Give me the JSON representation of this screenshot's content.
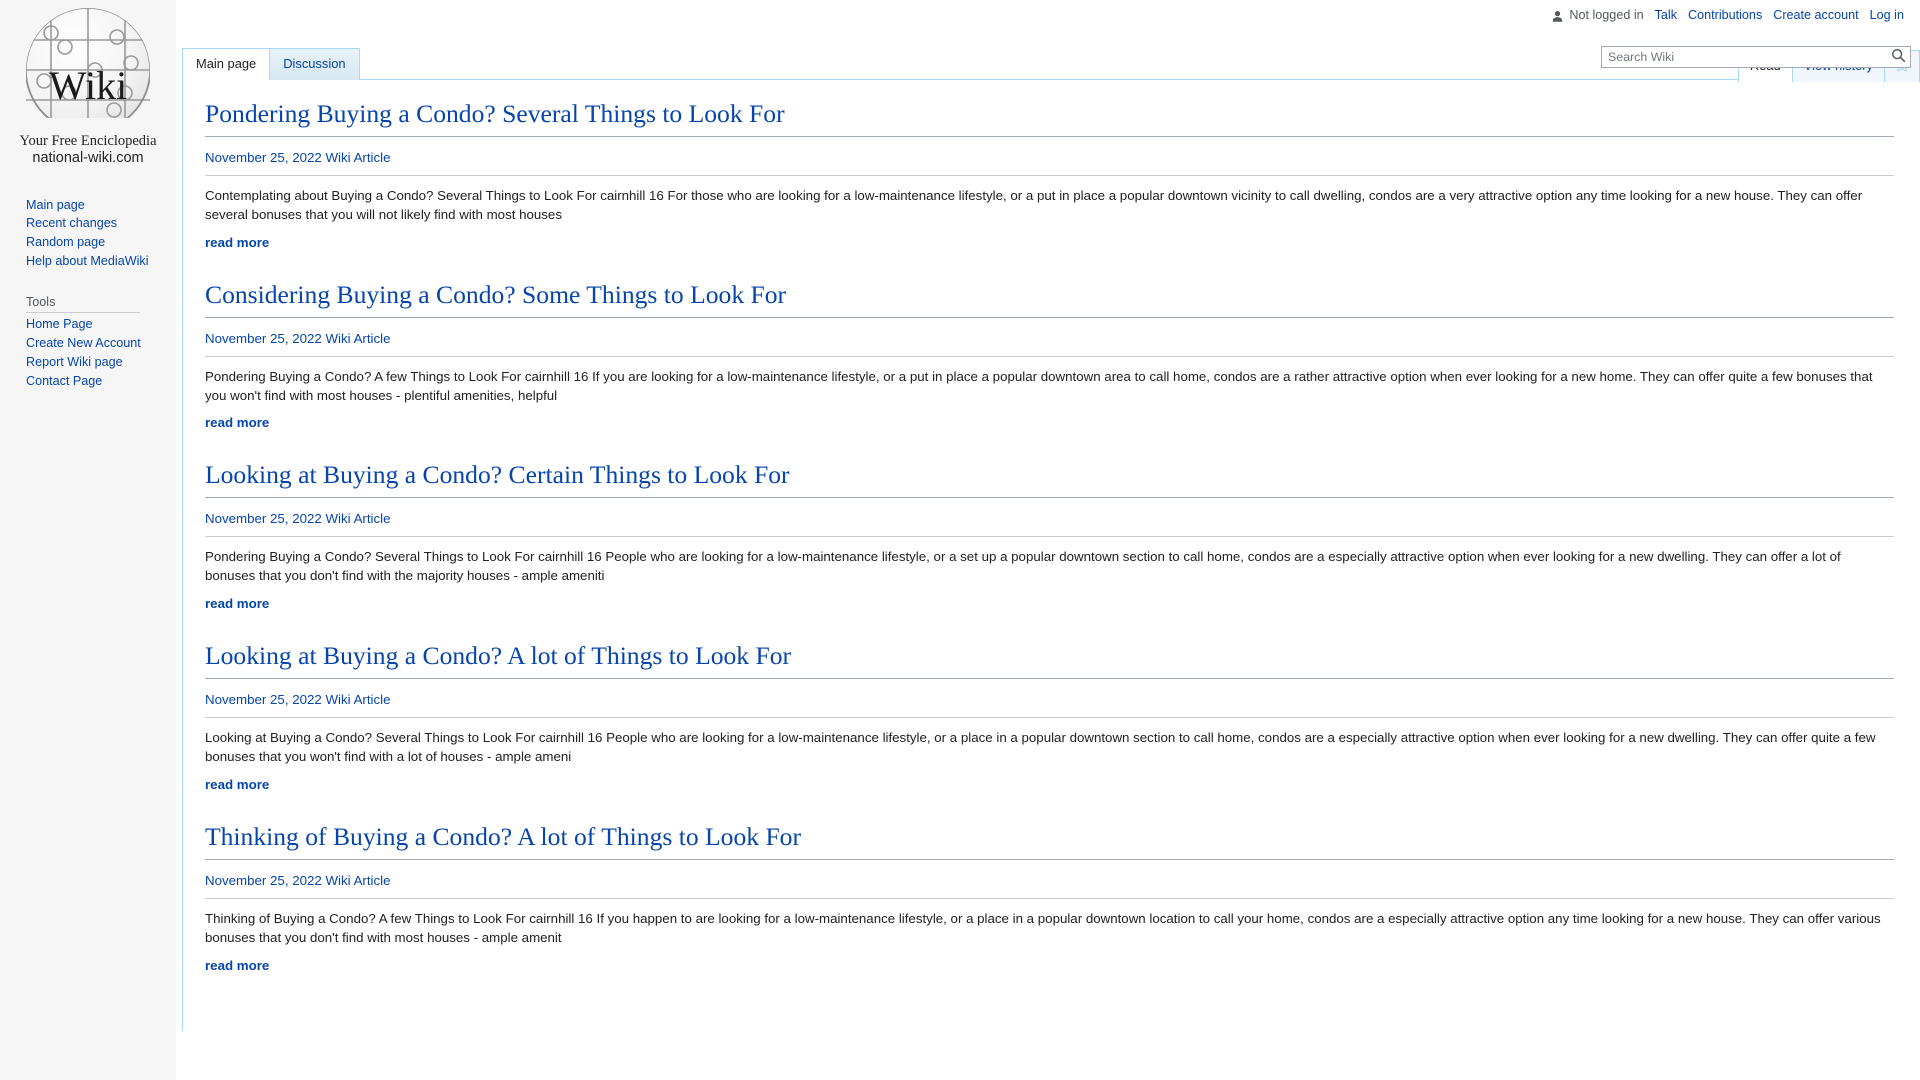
{
  "personal_bar": {
    "user_icon": "user-icon",
    "not_logged_in": "Not logged in",
    "links": [
      {
        "label": "Talk"
      },
      {
        "label": "Contributions"
      },
      {
        "label": "Create account"
      },
      {
        "label": "Log in"
      }
    ]
  },
  "logo": {
    "word": "Wiki",
    "tagline_1": "Your Free Enciclopedia",
    "tagline_2": "national-wiki.com"
  },
  "sidebar": {
    "navigation": [
      {
        "label": "Main page"
      },
      {
        "label": "Recent changes"
      },
      {
        "label": "Random page"
      },
      {
        "label": "Help about MediaWiki"
      }
    ],
    "tools_heading": "Tools",
    "tools": [
      {
        "label": "Home Page"
      },
      {
        "label": "Create New Account"
      },
      {
        "label": "Report Wiki page"
      },
      {
        "label": "Contact Page"
      }
    ]
  },
  "namespace_tabs": [
    {
      "label": "Main page",
      "selected": true
    },
    {
      "label": "Discussion",
      "selected": false
    }
  ],
  "action_tabs": [
    {
      "label": "Read",
      "selected": true
    },
    {
      "label": "View history",
      "selected": false
    }
  ],
  "watch_star_icon": "star-outline-icon",
  "search": {
    "placeholder": "Search Wiki",
    "value": "",
    "button_icon": "search-icon"
  },
  "colors": {
    "link": "#0645ad",
    "tab_border": "#a7d7f9",
    "sidebar_bg": "#f6f6f6",
    "text": "#202122"
  },
  "articles": [
    {
      "title": "Pondering Buying a Condo? Several Things to Look For",
      "date": "November 25, 2022",
      "category": "Wiki Article",
      "body": "Contemplating about Buying a Condo? Several Things to Look For cairnhill 16 For those who are looking for a low-maintenance lifestyle, or a put in place a popular downtown vicinity to call dwelling, condos are a very attractive option any time looking for a new house. They can offer several bonuses that you will not likely find with most houses",
      "read_more": "read more"
    },
    {
      "title": "Considering Buying a Condo? Some Things to Look For",
      "date": "November 25, 2022",
      "category": "Wiki Article",
      "body": "Pondering Buying a Condo? A few Things to Look For cairnhill 16 If you are looking for a low-maintenance lifestyle, or a put in place a popular downtown area to call home, condos are a rather attractive option when ever looking for a new home. They can offer quite a few bonuses that you won't find with most houses - plentiful amenities, helpful",
      "read_more": "read more"
    },
    {
      "title": "Looking at Buying a Condo? Certain Things to Look For",
      "date": "November 25, 2022",
      "category": "Wiki Article",
      "body": "Pondering Buying a Condo? Several Things to Look For cairnhill 16 People who are looking for a low-maintenance lifestyle, or a set up a popular downtown section to call home, condos are a especially attractive option when ever looking for a new dwelling. They can offer a lot of bonuses that you don't find with the majority houses - ample ameniti",
      "read_more": "read more"
    },
    {
      "title": "Looking at Buying a Condo? A lot of Things to Look For",
      "date": "November 25, 2022",
      "category": "Wiki Article",
      "body": "Looking at Buying a Condo? Several Things to Look For cairnhill 16 People who are looking for a low-maintenance lifestyle, or a place in a popular downtown section to call home, condos are a especially attractive option when ever looking for a new dwelling. They can offer quite a few bonuses that you won't find with a lot of houses - ample ameni",
      "read_more": "read more"
    },
    {
      "title": "Thinking of Buying a Condo? A lot of Things to Look For",
      "date": "November 25, 2022",
      "category": "Wiki Article",
      "body": "Thinking of Buying a Condo? A few Things to Look For cairnhill 16 If you happen to are looking for a low-maintenance lifestyle, or a place in a popular downtown location to call your home, condos are a especially attractive option any time looking for a new house. They can offer various bonuses that you don't find with most houses - ample amenit",
      "read_more": "read more"
    }
  ]
}
